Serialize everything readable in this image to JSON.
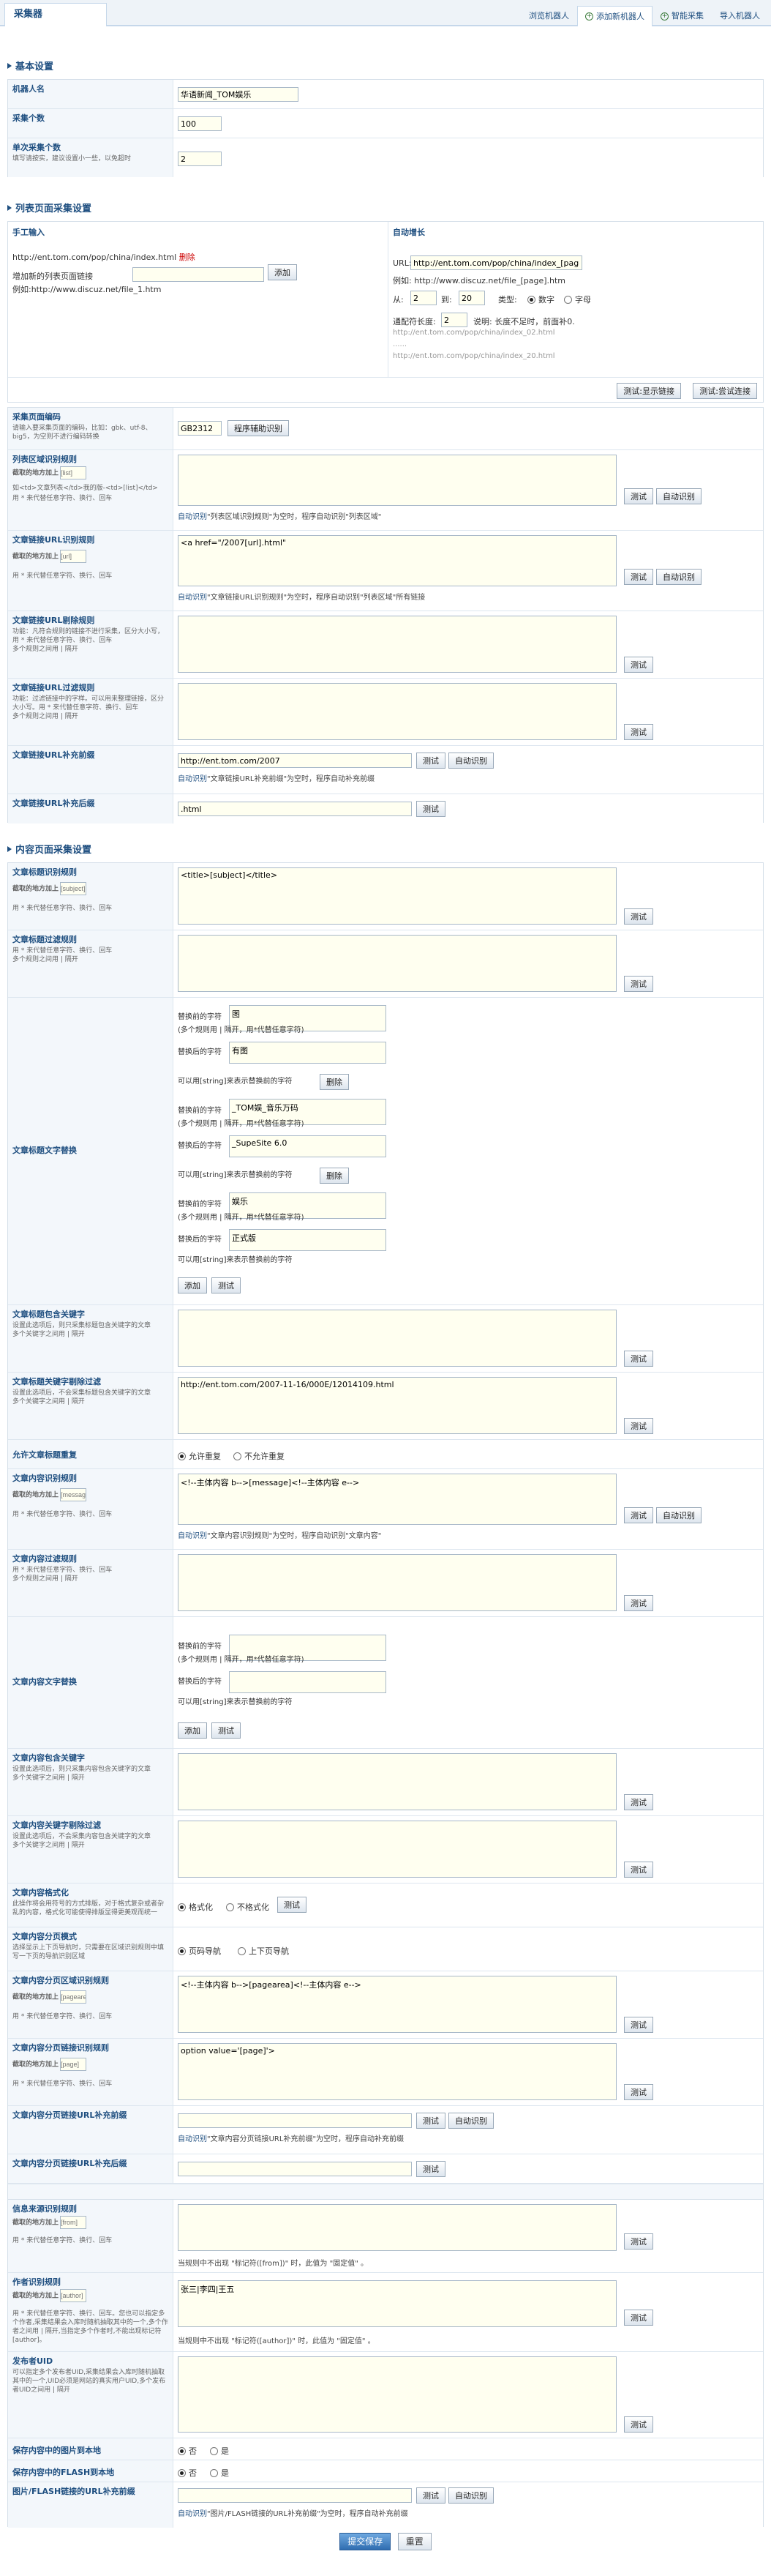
{
  "header": {
    "title": "采集器",
    "tabs": [
      "浏览机器人",
      "添加新机器人",
      "智能采集",
      "导入机器人"
    ]
  },
  "sections": {
    "basic": "基本设置",
    "list": "列表页面采集设置",
    "content": "内容页面采集设置"
  },
  "basic": {
    "robot_name_label": "机器人名",
    "robot_name": "华语新闻_TOM娱乐",
    "collect_count_label": "采集个数",
    "collect_count": "100",
    "per_count_label": "单次采集个数",
    "per_count_sub": "填写请按实，建议设置小一些，以免超时",
    "per_count": "2"
  },
  "manual": {
    "label": "手工输入",
    "url": "http://ent.tom.com/pop/china/index.html",
    "delete": "删除",
    "add_label": "增加新的列表页面链接",
    "example": "例如:http://www.discuz.net/file_1.htm",
    "add_btn": "添加"
  },
  "auto": {
    "label": "自动增长",
    "url_label": "URL:",
    "url": "http://ent.tom.com/pop/china/index_[page].html",
    "example": "例如: http://www.discuz.net/file_[page].htm",
    "from": "从:",
    "from_val": "2",
    "to": "到:",
    "to_val": "20",
    "type": "类型:",
    "type1": "数字",
    "type2": "字母",
    "pad_label": "通配符长度:",
    "pad_val": "2",
    "pad_note": "说明: 长度不足时，前面补0.",
    "ex1": "http://ent.tom.com/pop/china/index_02.html",
    "dots": "......",
    "ex2": "http://ent.tom.com/pop/china/index_20.html",
    "btn1": "测试:显示链接",
    "btn2": "测试:尝试连接"
  },
  "list_rows": {
    "charset_label": "采集页面编码",
    "charset_sub": "请输入要采集页面的编码，比如：gbk、utf-8、big5，为空则不进行编码转换",
    "charset": "GB2312",
    "charset_btn": "程序辅助识别",
    "area_label": "列表区域识别规则",
    "area_sub1": "截取的地方加上",
    "area_sub2": "如<td>文章列表</td>我的版-<td>[list]</td>",
    "area_sub3": "用 * 来代替任意字符、换行、回车",
    "area_ph": "[list]",
    "area_note": "\"列表区域识别规则\"为空时，程序自动识别\"列表区域\"",
    "link_label": "文章链接URL识别规则",
    "link_sub": "截取的地方加上",
    "link_ph": "[url]",
    "link_sub2": "用 * 来代替任意字符、换行、回车",
    "link_val": "<a href=\"/2007[url].html\"",
    "link_note": "\"文章链接URL识别规则\"为空时，程序自动识别\"列表区域\"所有链接",
    "linkdel_label": "文章链接URL剔除规则",
    "linkdel_sub": "功能：凡符合规则的链接不进行采集，区分大小写，用 * 来代替任意字符、换行、回车\n多个规则之间用 | 隔开",
    "linkfilter_label": "文章链接URL过滤规则",
    "linkfilter_sub": "功能：过滤链接中的字样。可以用来整理链接，区分大小写。用 * 来代替任意字符、换行、回车\n多个规则之间用 | 隔开",
    "prefix_label": "文章链接URL补充前缀",
    "prefix_val": "http://ent.tom.com/2007",
    "prefix_note": "\"文章链接URL补充前缀\"为空时，程序自动补充前缀",
    "suffix_label": "文章链接URL补充后缀",
    "suffix_val": ".html"
  },
  "btn": {
    "test": "测试",
    "auto": "自动识别",
    "auto_prefix": "自动识别",
    "add": "添加",
    "delete": "删除"
  },
  "content": {
    "title_label": "文章标题识别规则",
    "title_sub": "截取的地方加上",
    "title_ph": "[subject]",
    "title_sub2": "用 * 来代替任意字符、换行、回车",
    "title_val": "<title>[subject]</title>",
    "titlefilter_label": "文章标题过滤规则",
    "titlefilter_sub": "用 * 来代替任意字符、换行、回车\n多个规则之间用 | 隔开",
    "titlereplace_label": "文章标题文字替换",
    "rep_before": "替换前的字符",
    "rep_multi": "(多个规则用 | 隔开，用*代替任意字符)",
    "rep_after": "替换后的字符",
    "rep_string": "可以用[string]来表示替换前的字符",
    "reps": [
      {
        "before": "图",
        "after": "有图"
      },
      {
        "before": "_TOM娱_音乐万码",
        "after": "_SupeSite 6.0"
      },
      {
        "before": "娱乐",
        "after": "正式版"
      }
    ],
    "titlekey_label": "文章标题包含关键字",
    "titlekey_sub": "设置此选项后，则只采集标题包含关键字的文章\n多个关键字之间用 | 隔开",
    "titlenokey_label": "文章标题关键字剔除过滤",
    "titlenokey_sub": "设置此选项后，不会采集标题包含关键字的文章\n多个关键字之间用 | 隔开",
    "titlenokey_val": "http://ent.tom.com/2007-11-16/000E/12014109.html",
    "dup_label": "允许文章标题重复",
    "dup1": "允许重复",
    "dup2": "不允许重复",
    "body_label": "文章内容识别规则",
    "body_sub": "截取的地方加上",
    "body_ph": "[message]",
    "body_sub2": "用 * 来代替任意字符、换行、回车",
    "body_val": "<!--主体内容 b-->[message]<!--主体内容 e-->",
    "body_note": "\"文章内容识别规则\"为空时，程序自动识别\"文章内容\"",
    "bodyfilter_label": "文章内容过滤规则",
    "bodyfilter_sub": "用 * 来代替任意字符、换行、回车\n多个规则之间用 | 隔开",
    "bodyreplace_label": "文章内容文字替换",
    "bodykey_label": "文章内容包含关键字",
    "bodykey_sub": "设置此选项后，则只采集内容包含关键字的文章\n多个关键字之间用 | 隔开",
    "bodynokey_label": "文章内容关键字剔除过滤",
    "bodynokey_sub": "设置此选项后，不会采集内容包含关键字的文章\n多个关键字之间用 | 隔开",
    "fmt_label": "文章内容格式化",
    "fmt_sub": "此操作将会用符号的方式排版，对于格式复杂或者杂乱的内容，格式化可能使得排版显得更美观而统一",
    "fmt1": "格式化",
    "fmt2": "不格式化",
    "page_label": "文章内容分页模式",
    "page_sub": "选择显示上下页导航时，只需要在区域识别规则中填写一下页的导航识别区域",
    "page1": "页码导航",
    "page2": "上下页导航",
    "pagearea_label": "文章内容分页区域识别规则",
    "pagearea_ph": "[pagearea]",
    "pagearea_sub": "截取的地方加上",
    "pagearea_sub2": "用 * 来代替任意字符、换行、回车",
    "pagearea_val": "<!--主体内容 b-->[pagearea]<!--主体内容 e-->",
    "pagelink_label": "文章内容分页链接识别规则",
    "pagelink_ph": "[page]",
    "pagelink_sub": "截取的地方加上",
    "pagelink_sub2": "用 * 来代替任意字符、换行、回车",
    "pagelink_val": "option value='[page]'>",
    "pageprefix_label": "文章内容分页链接URL补充前缀",
    "pageprefix_note": "\"文章内容分页链接URL补充前缀\"为空时，程序自动补充前缀",
    "pagesuffix_label": "文章内容分页链接URL补充后缀",
    "from_label": "信息来源识别规则",
    "from_sub": "截取的地方加上",
    "from_ph": "[from]",
    "from_sub2": "用 * 来代替任意字符、换行、回车",
    "from_note": "当规则中不出现 \"标记符([from])\" 时，此值为 \"固定值\" 。",
    "author_label": "作者识别规则",
    "author_sub": "截取的地方加上",
    "author_ph": "[author]",
    "author_sub2": "用 * 来代替任意字符、换行、回车。您也可以指定多个作者,采集结果会入库时随机抽取其中的一个,多个作者之间用 | 隔开,当指定多个作者时,不能出现标记符[author]。",
    "author_val": "张三|李四|王五",
    "author_note": "当规则中不出现 \"标记符([author])\" 时，此值为 \"固定值\" 。",
    "uid_label": "发布者UID",
    "uid_sub": "可以指定多个发布者UID,采集结果会入库时随机抽取其中的一个,UID必须是网站的真实用户UID,多个发布者UID之间用 | 隔开",
    "img_label": "保存内容中的图片到本地",
    "img1": "否",
    "img2": "是",
    "flash_label": "保存内容中的FLASH到本地",
    "flash1": "否",
    "flash2": "是",
    "flashprefix_label": "图片/FLASH链接的URL补充前缀",
    "flashprefix_note": "\"图片/FLASH链接的URL补充前缀\"为空时，程序自动补充前缀"
  },
  "footer": {
    "submit": "提交保存",
    "reset": "重置"
  }
}
